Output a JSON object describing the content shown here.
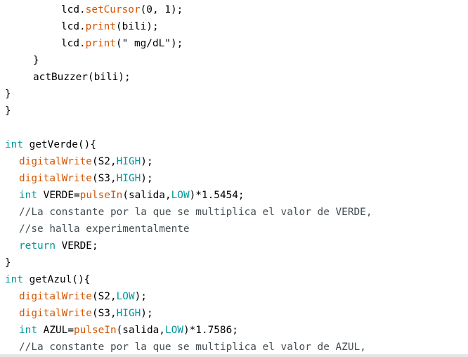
{
  "editor": {
    "colors": {
      "background": "#ffffff",
      "text": "#000000",
      "function": "#d35400",
      "keyword": "#00979c",
      "comment": "#434f54"
    },
    "lines": [
      {
        "indent": 2,
        "tokens": [
          {
            "t": "lcd.",
            "k": "plain"
          },
          {
            "t": "setCursor",
            "k": "func"
          },
          {
            "t": "(0, 1);",
            "k": "plain"
          }
        ]
      },
      {
        "indent": 2,
        "tokens": [
          {
            "t": "lcd.",
            "k": "plain"
          },
          {
            "t": "print",
            "k": "func"
          },
          {
            "t": "(bili);",
            "k": "plain"
          }
        ]
      },
      {
        "indent": 2,
        "tokens": [
          {
            "t": "lcd.",
            "k": "plain"
          },
          {
            "t": "print",
            "k": "func"
          },
          {
            "t": "(\" mg/dL\");",
            "k": "plain"
          }
        ]
      },
      {
        "indent": 1,
        "tokens": [
          {
            "t": "}",
            "k": "plain"
          }
        ]
      },
      {
        "indent": 1,
        "tokens": [
          {
            "t": "actBuzzer(bili);",
            "k": "plain"
          }
        ]
      },
      {
        "indent": 0,
        "tokens": [
          {
            "t": "}",
            "k": "plain"
          }
        ]
      },
      {
        "indent": 0,
        "tokens": [
          {
            "t": "}",
            "k": "plain"
          }
        ]
      },
      {
        "indent": 0,
        "tokens": []
      },
      {
        "indent": 0,
        "tokens": [
          {
            "t": "int",
            "k": "type"
          },
          {
            "t": " getVerde(){",
            "k": "plain"
          }
        ]
      },
      {
        "indent": 0.5,
        "tokens": [
          {
            "t": "digitalWrite",
            "k": "func"
          },
          {
            "t": "(S2,",
            "k": "plain"
          },
          {
            "t": "HIGH",
            "k": "const"
          },
          {
            "t": ");",
            "k": "plain"
          }
        ]
      },
      {
        "indent": 0.5,
        "tokens": [
          {
            "t": "digitalWrite",
            "k": "func"
          },
          {
            "t": "(S3,",
            "k": "plain"
          },
          {
            "t": "HIGH",
            "k": "const"
          },
          {
            "t": ");",
            "k": "plain"
          }
        ]
      },
      {
        "indent": 0.5,
        "tokens": [
          {
            "t": "int",
            "k": "type"
          },
          {
            "t": " VERDE=",
            "k": "plain"
          },
          {
            "t": "pulseIn",
            "k": "func"
          },
          {
            "t": "(salida,",
            "k": "plain"
          },
          {
            "t": "LOW",
            "k": "const"
          },
          {
            "t": ")*1.5454;",
            "k": "plain"
          }
        ]
      },
      {
        "indent": 0.5,
        "tokens": [
          {
            "t": "//La constante por la que se multiplica el valor de VERDE,",
            "k": "comment"
          }
        ]
      },
      {
        "indent": 0.5,
        "tokens": [
          {
            "t": "//se halla experimentalmente",
            "k": "comment"
          }
        ]
      },
      {
        "indent": 0.5,
        "tokens": [
          {
            "t": "return",
            "k": "type"
          },
          {
            "t": " VERDE;",
            "k": "plain"
          }
        ]
      },
      {
        "indent": 0,
        "tokens": [
          {
            "t": "}",
            "k": "plain"
          }
        ]
      },
      {
        "indent": 0,
        "tokens": [
          {
            "t": "int",
            "k": "type"
          },
          {
            "t": " getAzul(){",
            "k": "plain"
          }
        ]
      },
      {
        "indent": 0.5,
        "tokens": [
          {
            "t": "digitalWrite",
            "k": "func"
          },
          {
            "t": "(S2,",
            "k": "plain"
          },
          {
            "t": "LOW",
            "k": "const"
          },
          {
            "t": ");",
            "k": "plain"
          }
        ]
      },
      {
        "indent": 0.5,
        "tokens": [
          {
            "t": "digitalWrite",
            "k": "func"
          },
          {
            "t": "(S3,",
            "k": "plain"
          },
          {
            "t": "HIGH",
            "k": "const"
          },
          {
            "t": ");",
            "k": "plain"
          }
        ]
      },
      {
        "indent": 0.5,
        "tokens": [
          {
            "t": "int",
            "k": "type"
          },
          {
            "t": " AZUL=",
            "k": "plain"
          },
          {
            "t": "pulseIn",
            "k": "func"
          },
          {
            "t": "(salida,",
            "k": "plain"
          },
          {
            "t": "LOW",
            "k": "const"
          },
          {
            "t": ")*1.7586;",
            "k": "plain"
          }
        ]
      },
      {
        "indent": 0.5,
        "tokens": [
          {
            "t": "//La constante por la que se multiplica el valor de AZUL,",
            "k": "comment"
          }
        ]
      }
    ]
  }
}
